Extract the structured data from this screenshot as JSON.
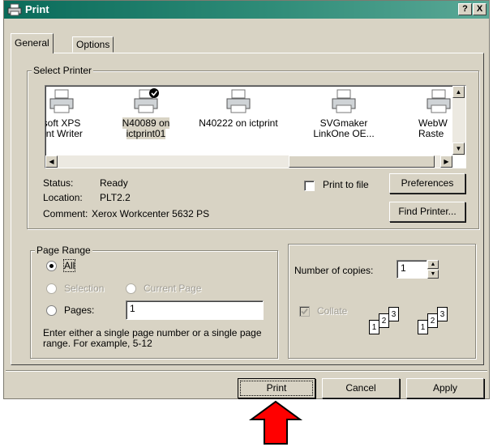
{
  "window": {
    "title": "Print",
    "help_label": "?",
    "close_label": "X"
  },
  "tabs": [
    {
      "label": "General",
      "active": true
    },
    {
      "label": "Options",
      "active": false
    }
  ],
  "select_printer": {
    "legend": "Select Printer",
    "printers": [
      {
        "line1": "soft XPS",
        "line2": "ent Writer",
        "selected": false,
        "default": false
      },
      {
        "line1": "N40089 on",
        "line2": "ictprint01",
        "selected": true,
        "default": true
      },
      {
        "line1": "N40222 on ictprint",
        "line2": "",
        "selected": false,
        "default": false
      },
      {
        "line1": "SVGmaker",
        "line2": "LinkOne OE...",
        "selected": false,
        "default": false
      },
      {
        "line1": "WebW",
        "line2": "Raste",
        "selected": false,
        "default": false
      }
    ],
    "status_label": "Status:",
    "status_value": "Ready",
    "location_label": "Location:",
    "location_value": "PLT2.2",
    "comment_label": "Comment:",
    "comment_value": "Xerox Workcenter 5632 PS",
    "print_to_file_label": "Print to file",
    "preferences_label": "Preferences",
    "find_printer_label": "Find Printer..."
  },
  "page_range": {
    "legend": "Page Range",
    "all_label": "All",
    "selection_label": "Selection",
    "current_page_label": "Current Page",
    "pages_label": "Pages:",
    "pages_value": "1",
    "hint": "Enter either a single page number or a single page range.  For example, 5-12"
  },
  "copies": {
    "number_label": "Number of copies:",
    "number_value": "1",
    "collate_label": "Collate",
    "collate_page_numbers": [
      "1",
      "2",
      "3"
    ]
  },
  "footer": {
    "print_label": "Print",
    "cancel_label": "Cancel",
    "apply_label": "Apply"
  },
  "colors": {
    "titlebar": "#0a6b5a",
    "dialog_bg": "#d8d3c4",
    "arrow": "#ff0000"
  }
}
